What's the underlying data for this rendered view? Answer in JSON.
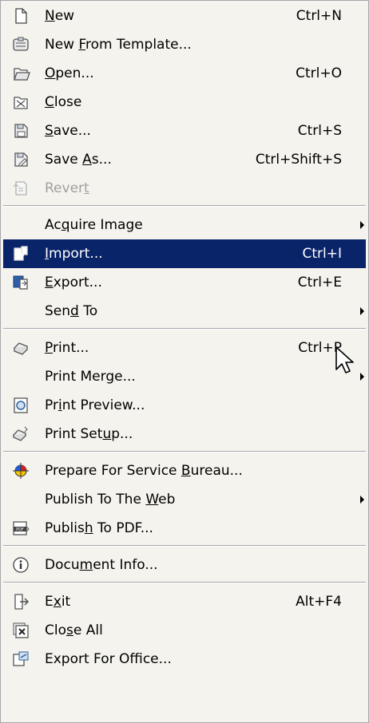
{
  "menu": {
    "items": [
      {
        "id": "new",
        "pre": "",
        "u": "N",
        "post": "ew",
        "shortcut": "Ctrl+N",
        "icon": "new-document-icon",
        "submenu": false,
        "highlighted": false,
        "disabled": false
      },
      {
        "id": "new-from-template",
        "pre": "New ",
        "u": "F",
        "post": "rom Template...",
        "shortcut": "",
        "icon": "template-icon",
        "submenu": false,
        "highlighted": false,
        "disabled": false
      },
      {
        "id": "open",
        "pre": "",
        "u": "O",
        "post": "pen...",
        "shortcut": "Ctrl+O",
        "icon": "open-icon",
        "submenu": false,
        "highlighted": false,
        "disabled": false
      },
      {
        "id": "close",
        "pre": "",
        "u": "C",
        "post": "lose",
        "shortcut": "",
        "icon": "close-document-icon",
        "submenu": false,
        "highlighted": false,
        "disabled": false
      },
      {
        "id": "save",
        "pre": "",
        "u": "S",
        "post": "ave...",
        "shortcut": "Ctrl+S",
        "icon": "save-icon",
        "submenu": false,
        "highlighted": false,
        "disabled": false
      },
      {
        "id": "save-as",
        "pre": "Save ",
        "u": "A",
        "post": "s...",
        "shortcut": "Ctrl+Shift+S",
        "icon": "save-as-icon",
        "submenu": false,
        "highlighted": false,
        "disabled": false
      },
      {
        "id": "revert",
        "pre": "Rever",
        "u": "t",
        "post": "",
        "shortcut": "",
        "icon": "revert-icon",
        "submenu": false,
        "highlighted": false,
        "disabled": true
      },
      {
        "id": "acquire-image",
        "pre": "Ac",
        "u": "q",
        "post": "uire Image",
        "shortcut": "",
        "icon": "",
        "submenu": true,
        "highlighted": false,
        "disabled": false
      },
      {
        "id": "import",
        "pre": "",
        "u": "I",
        "post": "mport...",
        "shortcut": "Ctrl+I",
        "icon": "import-icon",
        "submenu": false,
        "highlighted": true,
        "disabled": false
      },
      {
        "id": "export",
        "pre": "",
        "u": "E",
        "post": "xport...",
        "shortcut": "Ctrl+E",
        "icon": "export-icon",
        "submenu": false,
        "highlighted": false,
        "disabled": false
      },
      {
        "id": "send-to",
        "pre": "Sen",
        "u": "d",
        "post": " To",
        "shortcut": "",
        "icon": "",
        "submenu": true,
        "highlighted": false,
        "disabled": false
      },
      {
        "id": "print",
        "pre": "",
        "u": "P",
        "post": "rint...",
        "shortcut": "Ctrl+P",
        "icon": "print-icon",
        "submenu": false,
        "highlighted": false,
        "disabled": false
      },
      {
        "id": "print-merge",
        "pre": "Print Mer",
        "u": "g",
        "post": "e...",
        "shortcut": "",
        "icon": "",
        "submenu": true,
        "highlighted": false,
        "disabled": false
      },
      {
        "id": "print-preview",
        "pre": "Pr",
        "u": "i",
        "post": "nt Preview...",
        "shortcut": "",
        "icon": "print-preview-icon",
        "submenu": false,
        "highlighted": false,
        "disabled": false
      },
      {
        "id": "print-setup",
        "pre": "Print Set",
        "u": "u",
        "post": "p...",
        "shortcut": "",
        "icon": "print-setup-icon",
        "submenu": false,
        "highlighted": false,
        "disabled": false
      },
      {
        "id": "prepare-service-bureau",
        "pre": "Prepare For Service ",
        "u": "B",
        "post": "ureau...",
        "shortcut": "",
        "icon": "service-bureau-icon",
        "submenu": false,
        "highlighted": false,
        "disabled": false
      },
      {
        "id": "publish-web",
        "pre": "Publish To The ",
        "u": "W",
        "post": "eb",
        "shortcut": "",
        "icon": "",
        "submenu": true,
        "highlighted": false,
        "disabled": false
      },
      {
        "id": "publish-pdf",
        "pre": "Publis",
        "u": "h",
        "post": " To PDF...",
        "shortcut": "",
        "icon": "pdf-icon",
        "submenu": false,
        "highlighted": false,
        "disabled": false
      },
      {
        "id": "document-info",
        "pre": "Docu",
        "u": "m",
        "post": "ent Info...",
        "shortcut": "",
        "icon": "info-icon",
        "submenu": false,
        "highlighted": false,
        "disabled": false
      },
      {
        "id": "exit",
        "pre": "E",
        "u": "x",
        "post": "it",
        "shortcut": "Alt+F4",
        "icon": "exit-icon",
        "submenu": false,
        "highlighted": false,
        "disabled": false
      },
      {
        "id": "close-all",
        "pre": "Clo",
        "u": "s",
        "post": "e All",
        "shortcut": "",
        "icon": "close-all-icon",
        "submenu": false,
        "highlighted": false,
        "disabled": false
      },
      {
        "id": "export-for-office",
        "pre": "Export For Office...",
        "u": "",
        "post": "",
        "shortcut": "",
        "icon": "export-office-icon",
        "submenu": false,
        "highlighted": false,
        "disabled": false
      }
    ]
  },
  "colors": {
    "menu_background": "#f4f3ee",
    "highlight": "#0a246a",
    "disabled_text": "#a0a0a0"
  }
}
